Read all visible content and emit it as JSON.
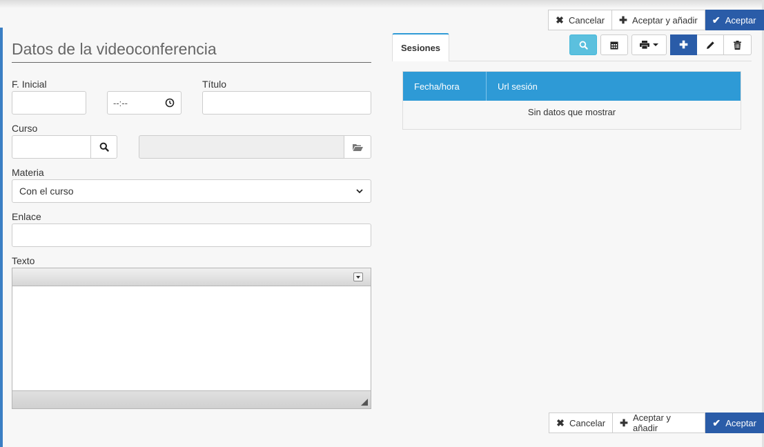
{
  "actions": {
    "cancel_label": "Cancelar",
    "accept_add_label": "Aceptar y añadir",
    "accept_label": "Aceptar"
  },
  "form": {
    "title": "Datos de la videoconferencia",
    "fecha_inicial": {
      "label": "F. Inicial",
      "value": ""
    },
    "hora": {
      "value": "--:--"
    },
    "titulo": {
      "label": "Título",
      "value": ""
    },
    "curso": {
      "label": "Curso",
      "code_value": "",
      "name_value": ""
    },
    "materia": {
      "label": "Materia",
      "selected": "Con el curso"
    },
    "enlace": {
      "label": "Enlace",
      "value": ""
    },
    "texto": {
      "label": "Texto",
      "value": ""
    }
  },
  "sessions": {
    "tab_label": "Sesiones",
    "columns": [
      "Fecha/hora",
      "Url sesión"
    ],
    "empty_message": "Sin datos que mostrar"
  },
  "colors": {
    "primary": "#2a5ca8",
    "info": "#5bc0de",
    "grid_header": "#2e9ad6"
  },
  "icons": {
    "cancel": "close-icon",
    "accept_add": "plus-icon",
    "accept": "check-icon",
    "search": "search-icon",
    "calendar": "calendar-icon",
    "print": "print-icon",
    "add": "plus-icon",
    "edit": "pencil-icon",
    "delete": "trash-icon",
    "folder": "folder-open-icon",
    "clock": "clock-icon"
  }
}
